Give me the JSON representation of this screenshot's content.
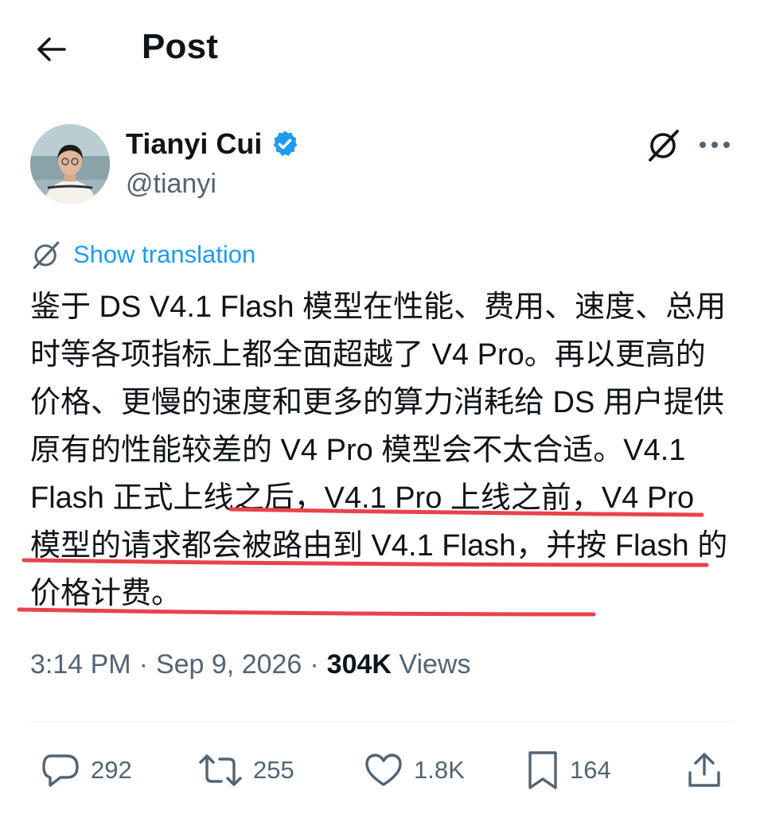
{
  "header": {
    "title": "Post"
  },
  "author": {
    "display_name": "Tianyi Cui",
    "handle": "@tianyi",
    "verified": true
  },
  "translate": {
    "label": "Show translation"
  },
  "post": {
    "text_plain": "鉴于 DS V4.1 Flash 模型在性能、费用、速度、总用时等各项指标上都全面超越了 V4 Pro。再以更高的价格、更慢的速度和更多的算力消耗给 DS 用户提供原有的性能较差的 V4 Pro 模型会不太合适。",
    "text_highlighted": "V4.1 Flash 正式上线之后，V4.1 Pro 上线之前，V4 Pro 模型的请求都会被路由到 V4.1 Flash，并按 Flash 的价格计费",
    "text_tail": "。"
  },
  "meta": {
    "time": "3:14 PM",
    "date": "Sep 9, 2026",
    "views_count": "304K",
    "views_label": "Views",
    "sep": "·"
  },
  "actions": {
    "replies": "292",
    "reposts": "255",
    "likes": "1.8K",
    "bookmarks": "164"
  },
  "colors": {
    "link": "#1d9bf0",
    "secondary": "#536471",
    "highlight_underline": "#e8434a",
    "verified": "#1d9bf0"
  },
  "icons": [
    "back-arrow-icon",
    "verified-badge-icon",
    "grok-icon",
    "more-icon",
    "translate-icon",
    "reply-icon",
    "repost-icon",
    "like-icon",
    "bookmark-icon",
    "share-icon"
  ]
}
